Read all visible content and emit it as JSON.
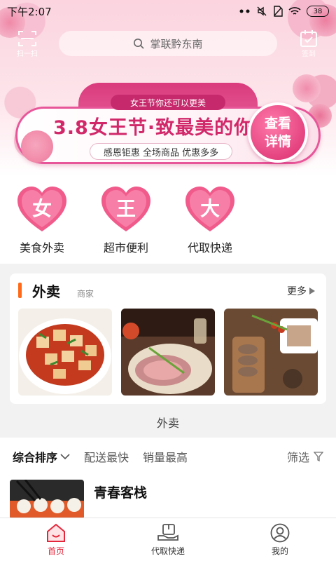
{
  "status": {
    "time": "下午2:07",
    "battery": "38"
  },
  "header": {
    "left_label": "扫一扫",
    "right_label": "签到",
    "search_placeholder": "掌联黔东南"
  },
  "banner": {
    "tag": "女王节你还可以更美",
    "title": "3.8女王节·致最美的你",
    "subtitle": "感恩钜惠 全场商品 优惠多多",
    "cta": "查看详情"
  },
  "categories": [
    {
      "char": "女",
      "label": "美食外卖"
    },
    {
      "char": "王",
      "label": "超市便利"
    },
    {
      "char": "大",
      "label": "代取快递"
    }
  ],
  "section": {
    "title": "外卖",
    "subtitle": "商家",
    "more": "更多"
  },
  "list_title": "外卖",
  "sort": {
    "items": [
      "综合排序",
      "配送最快",
      "销量最高"
    ],
    "filter": "筛选"
  },
  "shop": {
    "name": "青春客栈"
  },
  "nav": [
    {
      "label": "首页"
    },
    {
      "label": "代取快递"
    },
    {
      "label": "我的"
    }
  ],
  "colors": {
    "accent": "#e5273b",
    "banner_pink": "#d1286a",
    "section_bar": "#ff6a1a",
    "heart_pink": "#f05b8c"
  },
  "icons": {
    "scan": "scan-icon",
    "search": "search-icon",
    "checkin": "calendar-check-icon",
    "more_arrow": "triangle-right-icon",
    "sort_chevron": "chevron-down-icon",
    "filter": "filter-icon",
    "nav_home": "home-icon",
    "nav_delivery": "package-hand-icon",
    "nav_profile": "user-icon"
  }
}
